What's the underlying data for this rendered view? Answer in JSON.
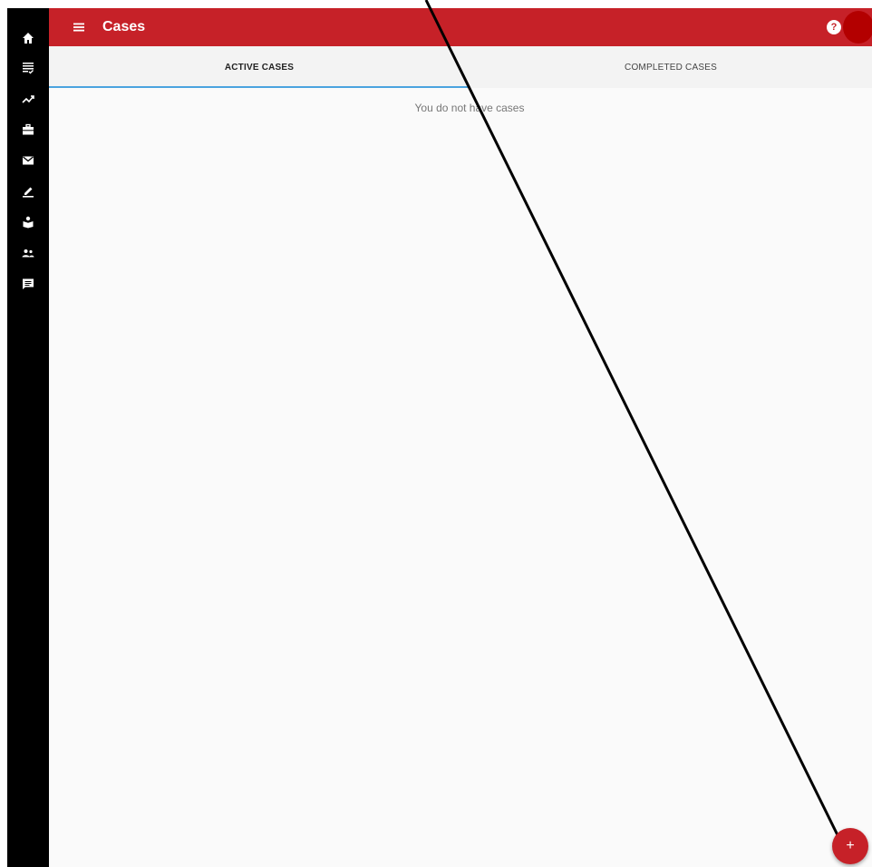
{
  "app": {
    "title": "Cases",
    "accent_color": "#c62128",
    "sidebar_color": "#000000"
  },
  "header": {
    "title": "Cases",
    "menu_icon": "menu-icon",
    "help_label": "?",
    "avatar_color": "#b30000"
  },
  "sidebar": {
    "items": [
      {
        "icon": "home-icon"
      },
      {
        "icon": "checklist-icon"
      },
      {
        "icon": "trending-icon"
      },
      {
        "icon": "briefcase-icon"
      },
      {
        "icon": "mail-icon"
      },
      {
        "icon": "edit-icon"
      },
      {
        "icon": "reader-icon"
      },
      {
        "icon": "people-icon"
      },
      {
        "icon": "feedback-icon"
      }
    ]
  },
  "tabs": [
    {
      "label": "ACTIVE CASES",
      "active": true
    },
    {
      "label": "COMPLETED CASES",
      "active": false
    }
  ],
  "main": {
    "empty_message": "You do not have cases"
  },
  "fab": {
    "label": "+",
    "icon": "add-icon"
  }
}
